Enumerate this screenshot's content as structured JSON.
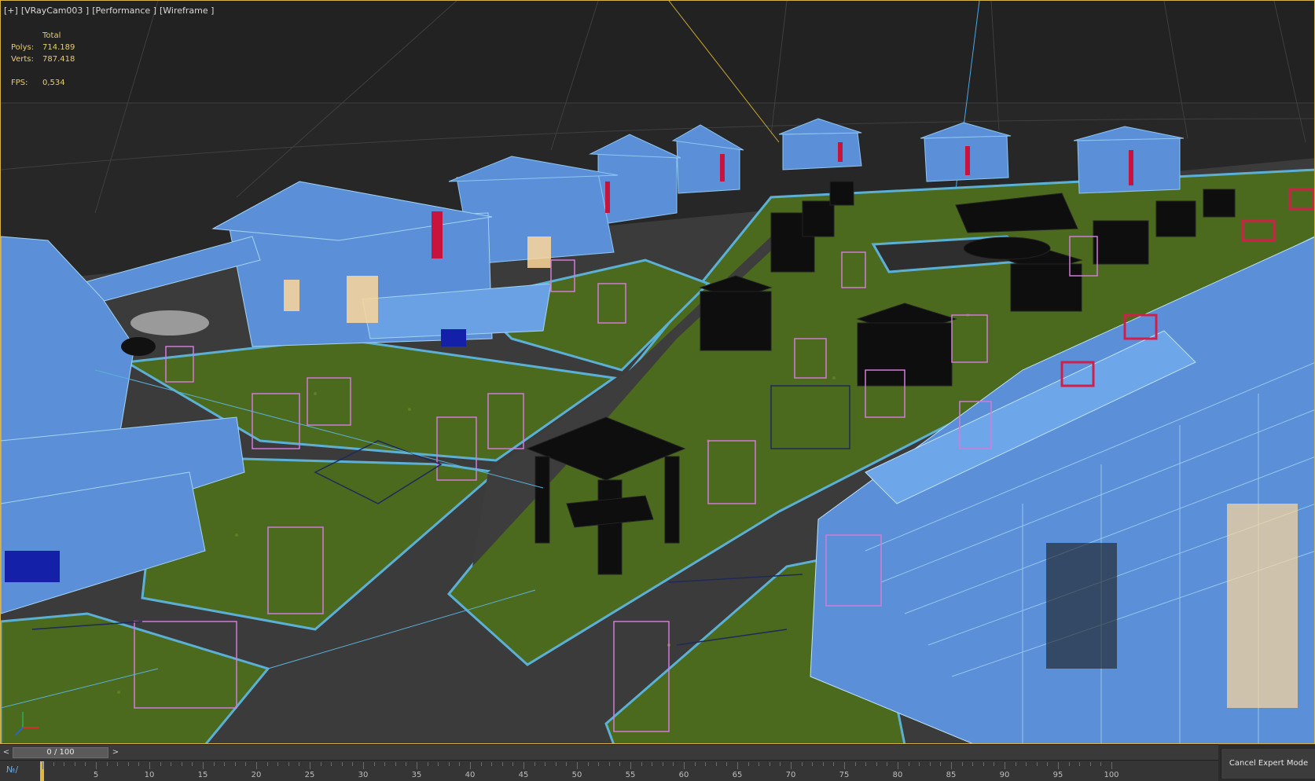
{
  "viewport": {
    "label_parts": [
      "[+]",
      "[VRayCam003 ]",
      "[Performance ]",
      "[Wireframe ]"
    ],
    "stats": {
      "header": "Total",
      "polys_label": "Polys:",
      "polys_value": "714.189",
      "verts_label": "Verts:",
      "verts_value": "787.418",
      "fps_label": "FPS:",
      "fps_value": "0,534"
    }
  },
  "time_slider": {
    "value": "0 / 100",
    "prev_icon": "chevron-left-icon",
    "next_icon": "chevron-right-icon"
  },
  "trackbar": {
    "ticks": [
      "5",
      "10",
      "15",
      "20",
      "25",
      "30",
      "35",
      "40",
      "45",
      "50",
      "55",
      "60",
      "65",
      "70",
      "75",
      "80",
      "85",
      "90",
      "95",
      "100"
    ],
    "curve_icon": "mini-curve-editor-icon"
  },
  "cancel_expert_mode": "Cancel Expert Mode",
  "colors": {
    "frame_border": "#d6b24a",
    "stats_text": "#e8cf6a",
    "grass": "#4a6a1c",
    "road": "#3e3e3e",
    "house_wire": "#5b8fd8",
    "gazebo": "#111111",
    "helper_box": "#d27bd8",
    "curb": "#5cb0d6"
  }
}
